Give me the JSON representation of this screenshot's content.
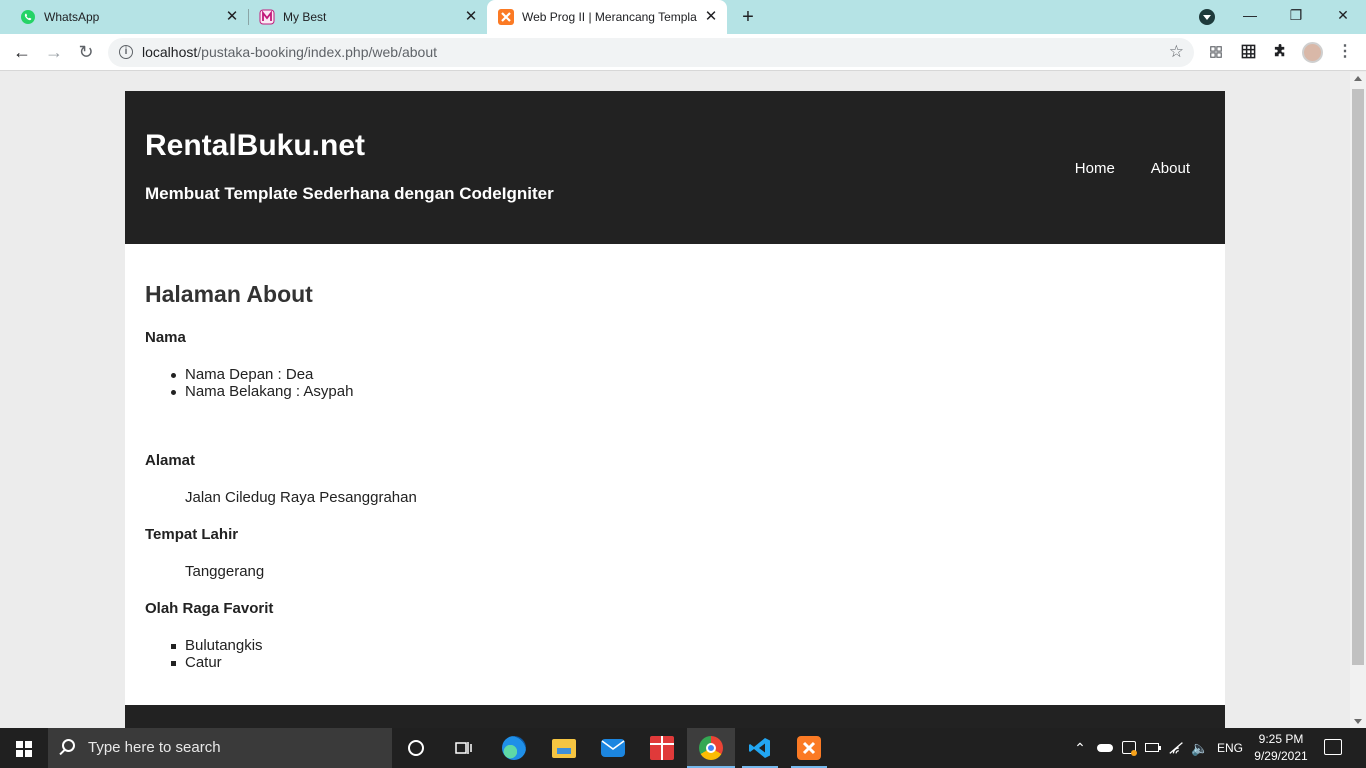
{
  "browser": {
    "tabs": [
      {
        "title": "WhatsApp",
        "icon": "whatsapp-icon",
        "active": false
      },
      {
        "title": "My Best",
        "icon": "my-best-icon",
        "active": false
      },
      {
        "title": "Web Prog II | Merancang Templa",
        "icon": "xampp-icon",
        "active": true
      }
    ],
    "window_controls": {
      "minimize": "—",
      "restore": "❐",
      "close": "✕"
    },
    "url_host": "localhost",
    "url_path": "/pustaka-booking/index.php/web/about"
  },
  "site": {
    "title": "RentalBuku.net",
    "subtitle": "Membuat Template Sederhana dengan CodeIgniter",
    "nav": {
      "home": "Home",
      "about": "About"
    }
  },
  "page": {
    "heading": "Halaman About",
    "nama_label": "Nama",
    "nama_items": [
      "Nama Depan : Dea",
      "Nama Belakang : Asypah"
    ],
    "alamat_label": "Alamat",
    "alamat_value": "Jalan Ciledug Raya Pesanggrahan",
    "tempat_lahir_label": "Tempat Lahir",
    "tempat_lahir_value": "Tanggerang",
    "olahraga_label": "Olah Raga Favorit",
    "olahraga_items": [
      "Bulutangkis",
      "Catur"
    ]
  },
  "taskbar": {
    "search_placeholder": "Type here to search",
    "language": "ENG",
    "time": "9:25 PM",
    "date": "9/29/2021"
  },
  "colors": {
    "tab_strip": "#b5e3e5",
    "site_header": "#222222",
    "taskbar": "#202020",
    "accent": "#76b9ed"
  }
}
